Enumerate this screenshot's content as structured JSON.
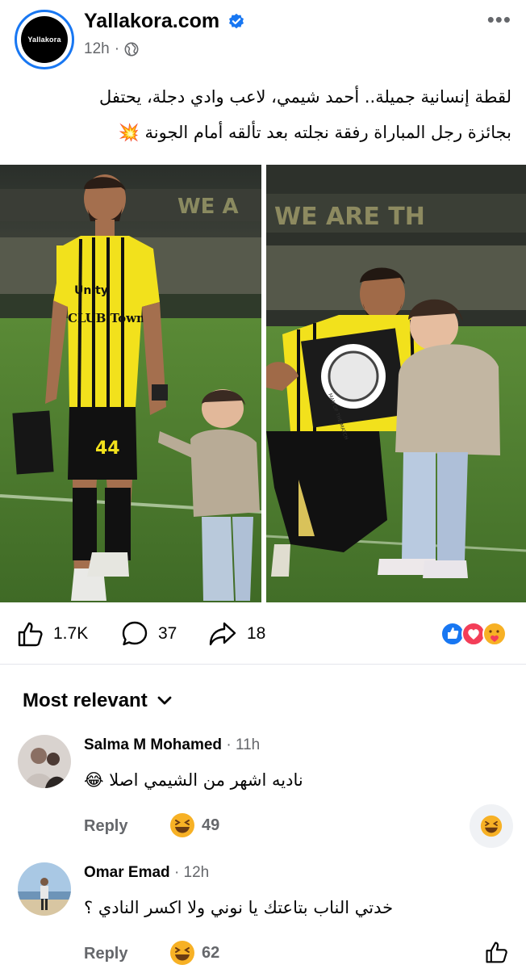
{
  "post": {
    "page_name": "Yallakora.com",
    "avatar_text": "Yallakora",
    "time": "12h",
    "separator": "·",
    "caption_line1": "لقطة إنسانية جميلة.. أحمد شيمي، لاعب وادي دجلة، يحتفل",
    "caption_line2": "بجائزة رجل المباراة رفقة نجلته بعد تألقه أمام الجونة",
    "caption_emoji": "💥"
  },
  "photo_text": {
    "banner_left": "WE A",
    "banner_right": "WE ARE TH",
    "jersey_sponsor": "Unity",
    "jersey_text": "CLUB Town",
    "jersey_number": "44",
    "award_text": "MAN OF THE MATCH"
  },
  "stats": {
    "likes": "1.7K",
    "comments": "37",
    "shares": "18"
  },
  "comments_section": {
    "sort_label": "Most relevant"
  },
  "comments": [
    {
      "author": "Salma M Mohamed",
      "time": "11h",
      "text": "ناديه اشهر من الشيمي اصلا",
      "emoji": "😂",
      "reply_label": "Reply",
      "reaction_count": "49"
    },
    {
      "author": "Omar Emad",
      "time": "12h",
      "text": "خدتي الناب بتاعتك يا نوني ولا اكسر النادي ؟",
      "reply_label": "Reply",
      "reaction_count": "62"
    }
  ],
  "colors": {
    "brand_blue": "#1877f2",
    "secondary_text": "#65676b",
    "jersey_yellow": "#f2e11c",
    "pitch_green": "#4a7a2e"
  },
  "icons": [
    "verified-badge-icon",
    "globe-icon",
    "more-options-icon",
    "like-icon",
    "comment-icon",
    "share-icon",
    "like-reaction-icon",
    "love-reaction-icon",
    "care-reaction-icon",
    "chevron-down-icon",
    "laughing-emoji-icon"
  ]
}
